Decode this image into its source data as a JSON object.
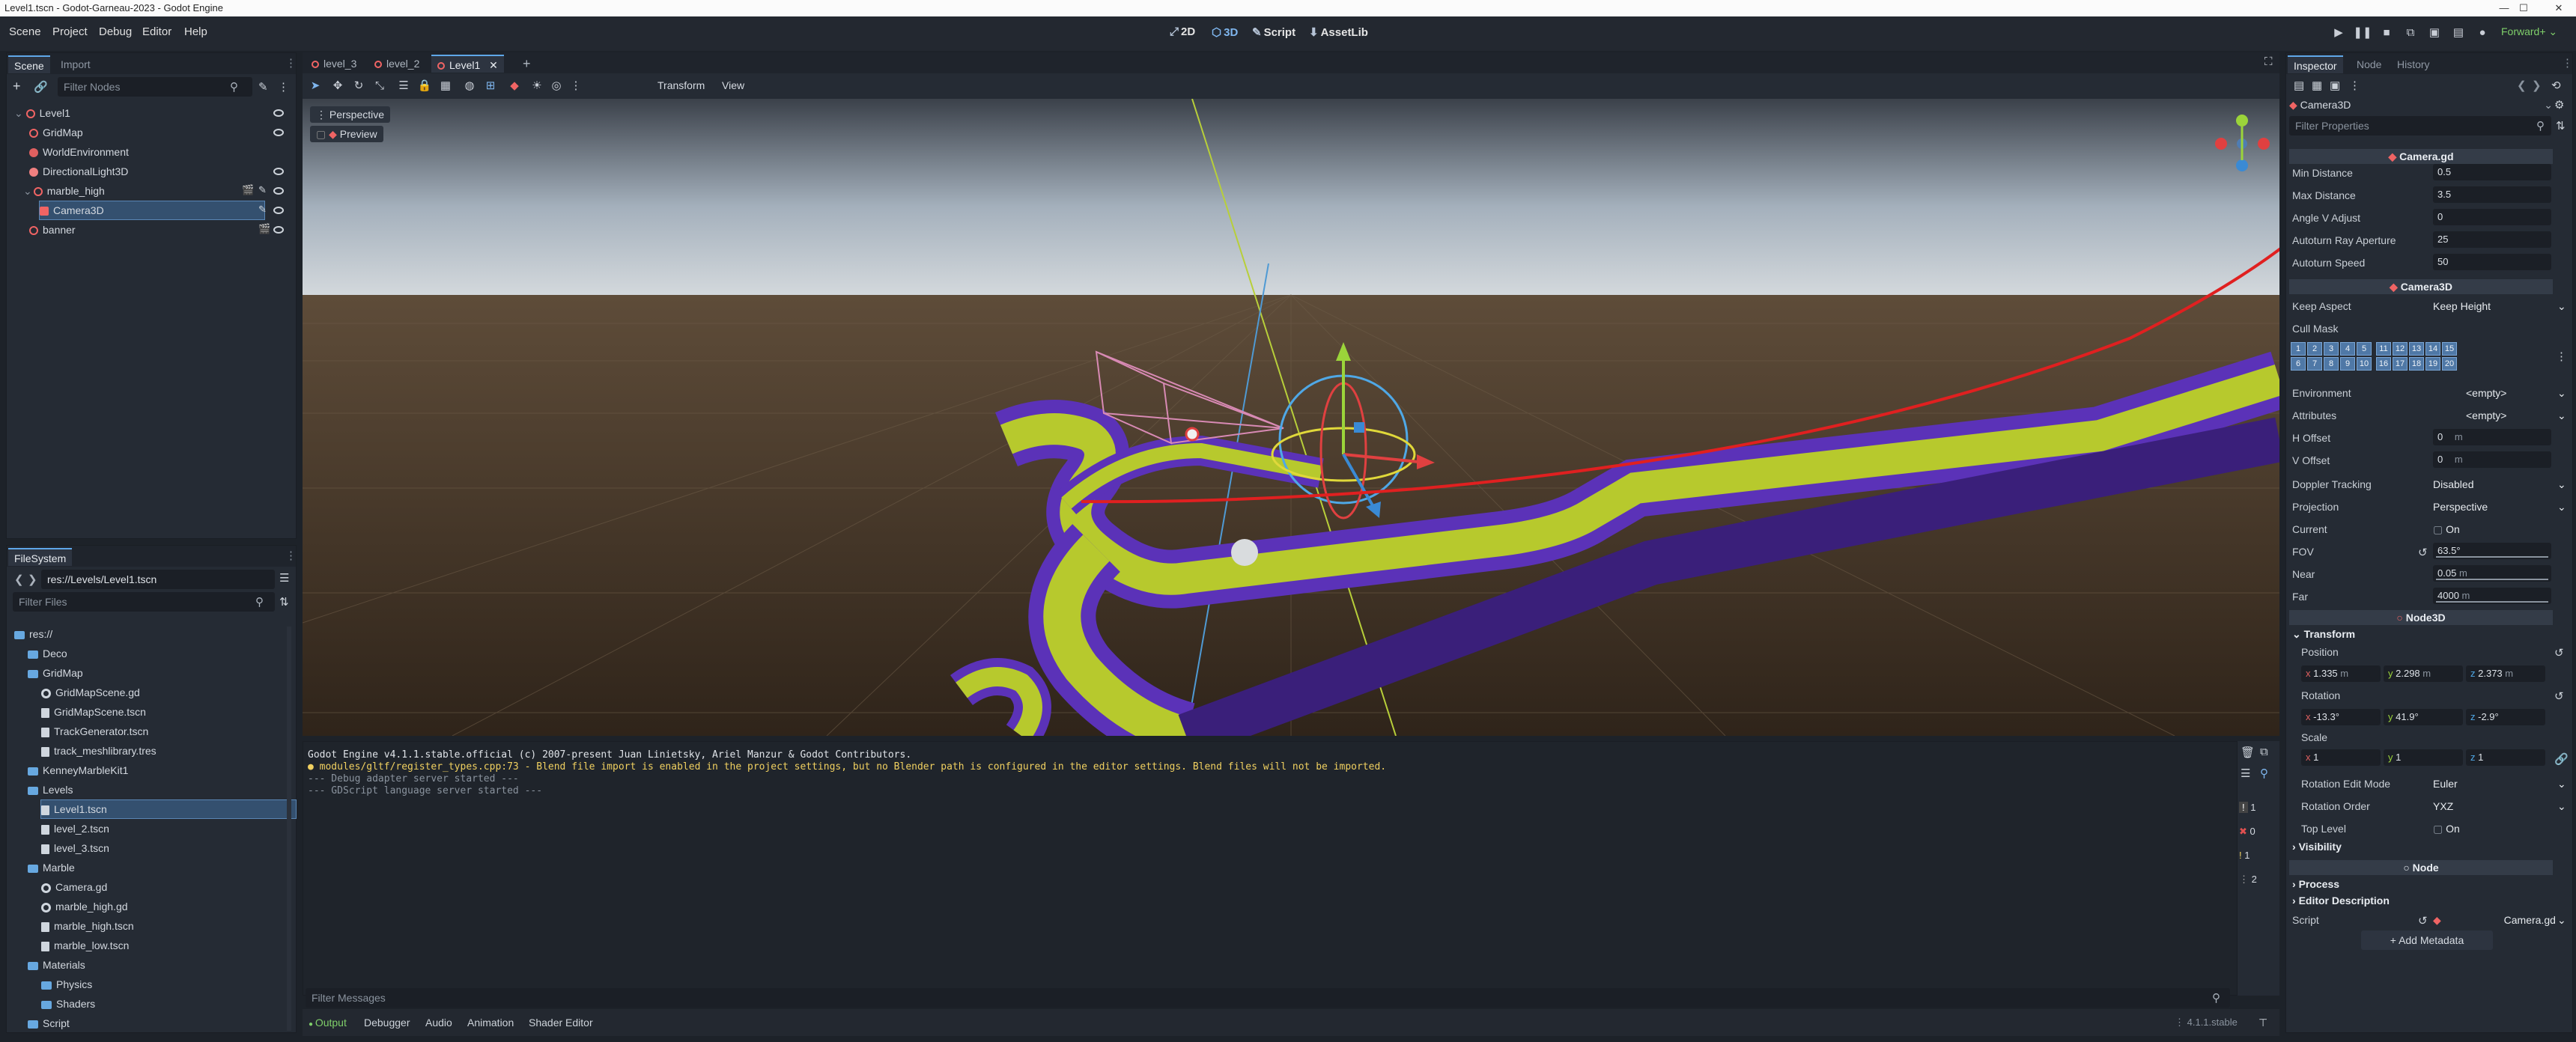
{
  "window": {
    "title": "Level1.tscn - Godot-Garneau-2023 - Godot Engine"
  },
  "menu": [
    "Scene",
    "Project",
    "Debug",
    "Editor",
    "Help"
  ],
  "workspaces": {
    "w2d": "2D",
    "w3d": "3D",
    "script": "Script",
    "assetlib": "AssetLib"
  },
  "renderer": "Forward+",
  "scene_dock": {
    "tabs": [
      "Scene",
      "Import"
    ],
    "filter_placeholder": "Filter Nodes",
    "nodes": [
      {
        "name": "Level1",
        "icon": "node3d-icon"
      },
      {
        "name": "GridMap",
        "icon": "gridmap-icon"
      },
      {
        "name": "WorldEnvironment",
        "icon": "world-environment-icon"
      },
      {
        "name": "DirectionalLight3D",
        "icon": "light-icon"
      },
      {
        "name": "marble_high",
        "icon": "node3d-icon"
      },
      {
        "name": "Camera3D",
        "icon": "camera-icon"
      },
      {
        "name": "banner",
        "icon": "node3d-icon"
      }
    ]
  },
  "filesystem": {
    "title": "FileSystem",
    "path": "res://Levels/Level1.tscn",
    "filter_placeholder": "Filter Files",
    "items": [
      {
        "name": "res://",
        "kind": "folder",
        "depth": 0
      },
      {
        "name": "Deco",
        "kind": "folder",
        "depth": 1
      },
      {
        "name": "GridMap",
        "kind": "folder",
        "depth": 1
      },
      {
        "name": "GridMapScene.gd",
        "kind": "script",
        "depth": 2
      },
      {
        "name": "GridMapScene.tscn",
        "kind": "file",
        "depth": 2
      },
      {
        "name": "TrackGenerator.tscn",
        "kind": "file",
        "depth": 2
      },
      {
        "name": "track_meshlibrary.tres",
        "kind": "file",
        "depth": 2
      },
      {
        "name": "KenneyMarbleKit1",
        "kind": "folder",
        "depth": 1
      },
      {
        "name": "Levels",
        "kind": "folder",
        "depth": 1
      },
      {
        "name": "Level1.tscn",
        "kind": "file",
        "depth": 2
      },
      {
        "name": "level_2.tscn",
        "kind": "file",
        "depth": 2
      },
      {
        "name": "level_3.tscn",
        "kind": "file",
        "depth": 2
      },
      {
        "name": "Marble",
        "kind": "folder",
        "depth": 1
      },
      {
        "name": "Camera.gd",
        "kind": "script",
        "depth": 2
      },
      {
        "name": "marble_high.gd",
        "kind": "script",
        "depth": 2
      },
      {
        "name": "marble_high.tscn",
        "kind": "file",
        "depth": 2
      },
      {
        "name": "marble_low.tscn",
        "kind": "file",
        "depth": 2
      },
      {
        "name": "Materials",
        "kind": "folder",
        "depth": 1
      },
      {
        "name": "Physics",
        "kind": "folder",
        "depth": 2
      },
      {
        "name": "Shaders",
        "kind": "folder",
        "depth": 2
      },
      {
        "name": "Script",
        "kind": "folder",
        "depth": 1
      }
    ]
  },
  "scene_tabs": [
    "level_3",
    "level_2",
    "Level1"
  ],
  "viewport_toolbar": {
    "transform": "Transform",
    "view": "View"
  },
  "viewport": {
    "perspective": "Perspective",
    "preview": "Preview"
  },
  "output": {
    "lines": [
      "Godot Engine v4.1.1.stable.official (c) 2007-present Juan Linietsky, Ariel Manzur & Godot Contributors.",
      "modules/gltf/register_types.cpp:73 - Blend file import is enabled in the project settings, but no Blender path is configured in the editor settings. Blend files will not be imported.",
      "--- Debug adapter server started ---",
      "--- GDScript language server started ---"
    ],
    "filter_placeholder": "Filter Messages",
    "counts": [
      "1",
      "0",
      "1",
      "2"
    ]
  },
  "bottom_tabs": [
    "Output",
    "Debugger",
    "Audio",
    "Animation",
    "Shader Editor"
  ],
  "version": "4.1.1.stable",
  "inspector": {
    "tabs": [
      "Inspector",
      "Node",
      "History"
    ],
    "object": "Camera3D",
    "filter_placeholder": "Filter Properties",
    "script_section": "Camera.gd",
    "script_props": [
      {
        "label": "Min Distance",
        "value": "0.5"
      },
      {
        "label": "Max Distance",
        "value": "3.5"
      },
      {
        "label": "Angle V Adjust",
        "value": "0"
      },
      {
        "label": "Autoturn Ray Aperture",
        "value": "25"
      },
      {
        "label": "Autoturn Speed",
        "value": "50"
      }
    ],
    "camera_section": "Camera3D",
    "keep_aspect": {
      "label": "Keep Aspect",
      "value": "Keep Height"
    },
    "cull_mask": {
      "label": "Cull Mask",
      "bits": [
        "1",
        "2",
        "3",
        "4",
        "5",
        "6",
        "7",
        "8",
        "9",
        "10",
        "11",
        "12",
        "13",
        "14",
        "15",
        "16",
        "17",
        "18",
        "19",
        "20"
      ]
    },
    "environment": {
      "label": "Environment",
      "value": "<empty>"
    },
    "attributes": {
      "label": "Attributes",
      "value": "<empty>"
    },
    "h_offset": {
      "label": "H Offset",
      "value": "0",
      "unit": "m"
    },
    "v_offset": {
      "label": "V Offset",
      "value": "0",
      "unit": "m"
    },
    "doppler": {
      "label": "Doppler Tracking",
      "value": "Disabled"
    },
    "projection": {
      "label": "Projection",
      "value": "Perspective"
    },
    "current": {
      "label": "Current",
      "value": "On"
    },
    "fov": {
      "label": "FOV",
      "value": "63.5",
      "unit": "°"
    },
    "near": {
      "label": "Near",
      "value": "0.05",
      "unit": "m"
    },
    "far": {
      "label": "Far",
      "value": "4000",
      "unit": "m"
    },
    "node3d_section": "Node3D",
    "transform": {
      "title": "Transform",
      "position": "Position",
      "rotation": "Rotation",
      "scale": "Scale",
      "pos": {
        "x": "1.335",
        "y": "2.298",
        "z": "2.373",
        "unit": "m"
      },
      "rot": {
        "x": "-13.3",
        "y": "41.9",
        "z": "-2.9",
        "unit": "°"
      },
      "scl": {
        "x": "1",
        "y": "1",
        "z": "1"
      }
    },
    "rotation_edit_mode": {
      "label": "Rotation Edit Mode",
      "value": "Euler"
    },
    "rotation_order": {
      "label": "Rotation Order",
      "value": "YXZ"
    },
    "top_level": {
      "label": "Top Level",
      "value": "On"
    },
    "visibility": "Visibility",
    "node_section": "Node",
    "process": "Process",
    "editor_description": "Editor Description",
    "script": {
      "label": "Script",
      "value": "Camera.gd"
    },
    "add_metadata": "Add Metadata"
  },
  "colors": {
    "accent": "#5fa7e8",
    "track_yellow": "#b7c92d",
    "track_purple": "#5b32b8",
    "annotation": "#e02020"
  }
}
